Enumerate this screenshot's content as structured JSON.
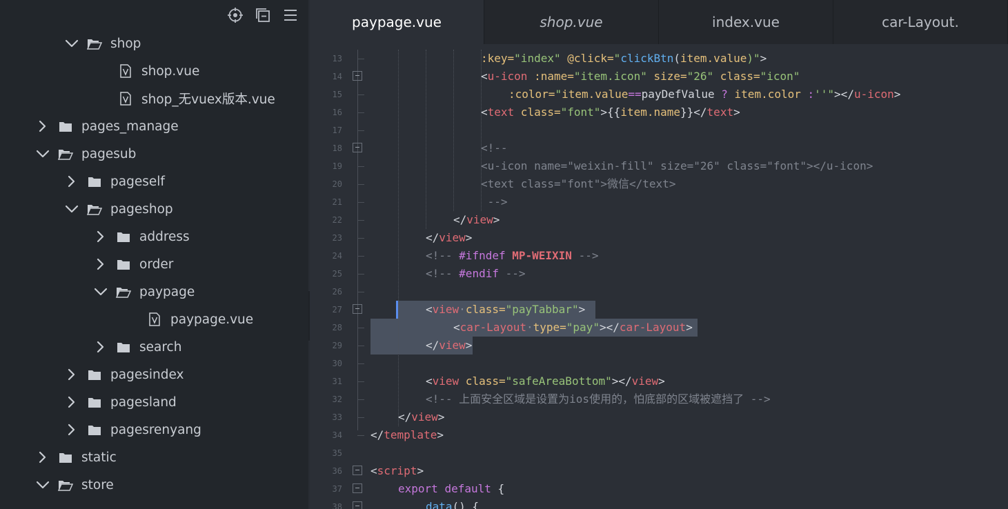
{
  "sidebar": {
    "toolbar": [
      {
        "name": "locate-icon"
      },
      {
        "name": "collapse-all-icon"
      },
      {
        "name": "menu-icon"
      }
    ],
    "tree": [
      {
        "label": "shop",
        "type": "folder",
        "expanded": true,
        "depth": 1
      },
      {
        "label": "shop.vue",
        "type": "file",
        "depth": 2
      },
      {
        "label": "shop_无vuex版本.vue",
        "type": "file",
        "depth": 2
      },
      {
        "label": "pages_manage",
        "type": "folder",
        "expanded": false,
        "depth": 0
      },
      {
        "label": "pagesub",
        "type": "folder",
        "expanded": true,
        "depth": 0
      },
      {
        "label": "pageself",
        "type": "folder",
        "expanded": false,
        "depth": 1
      },
      {
        "label": "pageshop",
        "type": "folder",
        "expanded": true,
        "depth": 1
      },
      {
        "label": "address",
        "type": "folder",
        "expanded": false,
        "depth": 2
      },
      {
        "label": "order",
        "type": "folder",
        "expanded": false,
        "depth": 2
      },
      {
        "label": "paypage",
        "type": "folder",
        "expanded": true,
        "depth": 2
      },
      {
        "label": "paypage.vue",
        "type": "file",
        "depth": 3
      },
      {
        "label": "search",
        "type": "folder",
        "expanded": false,
        "depth": 2
      },
      {
        "label": "pagesindex",
        "type": "folder",
        "expanded": false,
        "depth": 1
      },
      {
        "label": "pagesland",
        "type": "folder",
        "expanded": false,
        "depth": 1
      },
      {
        "label": "pagesrenyang",
        "type": "folder",
        "expanded": false,
        "depth": 1
      },
      {
        "label": "static",
        "type": "folder",
        "expanded": false,
        "depth": 0
      },
      {
        "label": "store",
        "type": "folder",
        "expanded": true,
        "depth": 0
      }
    ]
  },
  "tabs": [
    {
      "label": "paypage.vue",
      "active": true,
      "italic": false
    },
    {
      "label": "shop.vue",
      "active": false,
      "italic": true
    },
    {
      "label": "index.vue",
      "active": false,
      "italic": false
    },
    {
      "label": "car-Layout.",
      "active": false,
      "italic": false
    }
  ],
  "editor": {
    "lines": [
      {
        "n": "13",
        "fold": false,
        "indent": 4,
        "tokens": [
          [
            ":key=",
            "t-attr"
          ],
          [
            "\"index\"",
            "t-str"
          ],
          [
            " @click=",
            "t-attr"
          ],
          [
            "\"",
            "t-str"
          ],
          [
            "clickBtn",
            "t-fn"
          ],
          [
            "(",
            "t-p"
          ],
          [
            "item.value",
            "t-var"
          ],
          [
            ")\"",
            "t-str"
          ],
          [
            ">",
            "t-p"
          ]
        ]
      },
      {
        "n": "14",
        "fold": true,
        "indent": 4,
        "tokens": [
          [
            "<",
            "t-p"
          ],
          [
            "u-icon",
            "t-tag"
          ],
          [
            " :name=",
            "t-attr"
          ],
          [
            "\"item.icon\"",
            "t-str"
          ],
          [
            " size=",
            "t-attr"
          ],
          [
            "\"26\"",
            "t-str"
          ],
          [
            " class=",
            "t-attr"
          ],
          [
            "\"icon\"",
            "t-str"
          ]
        ]
      },
      {
        "n": "15",
        "fold": false,
        "indent": 5,
        "tokens": [
          [
            ":color=",
            "t-attr"
          ],
          [
            "\"",
            "t-str"
          ],
          [
            "item.value",
            "t-var"
          ],
          [
            "==",
            "t-kw"
          ],
          [
            "payDefValue ",
            "t-p"
          ],
          [
            "?",
            "t-kw"
          ],
          [
            " item.color ",
            "t-var"
          ],
          [
            ":",
            "t-kw"
          ],
          [
            "''\"",
            "t-str"
          ],
          [
            "></",
            "t-p"
          ],
          [
            "u-icon",
            "t-tag"
          ],
          [
            ">",
            "t-p"
          ]
        ]
      },
      {
        "n": "16",
        "fold": false,
        "indent": 4,
        "tokens": [
          [
            "<",
            "t-p"
          ],
          [
            "text",
            "t-tag"
          ],
          [
            " class=",
            "t-attr"
          ],
          [
            "\"font\"",
            "t-str"
          ],
          [
            ">{{",
            "t-p"
          ],
          [
            "item.name",
            "t-var"
          ],
          [
            "}}</",
            "t-p"
          ],
          [
            "text",
            "t-tag"
          ],
          [
            ">",
            "t-p"
          ]
        ]
      },
      {
        "n": "17",
        "fold": false,
        "indent": 0,
        "tokens": []
      },
      {
        "n": "18",
        "fold": true,
        "indent": 4,
        "tokens": [
          [
            "<!--",
            "t-cmt"
          ]
        ]
      },
      {
        "n": "19",
        "fold": false,
        "indent": 4,
        "tokens": [
          [
            "<u-icon name=\"weixin-fill\" size=\"26\" class=\"font\"></u-icon>",
            "t-cmt"
          ]
        ]
      },
      {
        "n": "20",
        "fold": false,
        "indent": 4,
        "tokens": [
          [
            "<text class=\"font\">微信</text>",
            "t-cmt"
          ]
        ]
      },
      {
        "n": "21",
        "fold": false,
        "indent": 4,
        "tokens": [
          [
            " -->",
            "t-cmt"
          ]
        ]
      },
      {
        "n": "22",
        "fold": false,
        "indent": 3,
        "tokens": [
          [
            "</",
            "t-p"
          ],
          [
            "view",
            "t-tag"
          ],
          [
            ">",
            "t-p"
          ]
        ]
      },
      {
        "n": "23",
        "fold": false,
        "indent": 2,
        "tokens": [
          [
            "</",
            "t-p"
          ],
          [
            "view",
            "t-tag"
          ],
          [
            ">",
            "t-p"
          ]
        ]
      },
      {
        "n": "24",
        "fold": false,
        "indent": 2,
        "tokens": [
          [
            "<!-- ",
            "t-cmt"
          ],
          [
            "#ifndef ",
            "t-kw"
          ],
          [
            "MP-WEIXIN",
            "t-def"
          ],
          [
            " -->",
            "t-cmt"
          ]
        ]
      },
      {
        "n": "25",
        "fold": false,
        "indent": 2,
        "tokens": [
          [
            "<!-- ",
            "t-cmt"
          ],
          [
            "#endif",
            "t-kw"
          ],
          [
            " -->",
            "t-cmt"
          ]
        ]
      },
      {
        "n": "26",
        "fold": false,
        "indent": 0,
        "tokens": []
      },
      {
        "n": "27",
        "fold": true,
        "indent": 2,
        "sel": true,
        "tokens": [
          [
            "<",
            "t-p"
          ],
          [
            "view",
            "t-tag"
          ],
          [
            "·",
            "t-gr"
          ],
          [
            "class=",
            "t-attr"
          ],
          [
            "\"payTabbar\"",
            "t-str"
          ],
          [
            ">",
            "t-p"
          ]
        ]
      },
      {
        "n": "28",
        "fold": false,
        "indent": 3,
        "sel": true,
        "tokens": [
          [
            "<",
            "t-p"
          ],
          [
            "car-Layout",
            "t-tag"
          ],
          [
            "·",
            "t-gr"
          ],
          [
            "type=",
            "t-attr"
          ],
          [
            "\"pay\"",
            "t-str"
          ],
          [
            "></",
            "t-p"
          ],
          [
            "car-Layout",
            "t-tag"
          ],
          [
            ">",
            "t-p"
          ]
        ]
      },
      {
        "n": "29",
        "fold": false,
        "indent": 2,
        "sel": true,
        "tokens": [
          [
            "</",
            "t-p"
          ],
          [
            "view",
            "t-tag"
          ],
          [
            ">",
            "t-p"
          ]
        ]
      },
      {
        "n": "30",
        "fold": false,
        "indent": 0,
        "tokens": []
      },
      {
        "n": "31",
        "fold": false,
        "indent": 2,
        "tokens": [
          [
            "<",
            "t-p"
          ],
          [
            "view",
            "t-tag"
          ],
          [
            " class=",
            "t-attr"
          ],
          [
            "\"safeAreaBottom\"",
            "t-str"
          ],
          [
            "></",
            "t-p"
          ],
          [
            "view",
            "t-tag"
          ],
          [
            ">",
            "t-p"
          ]
        ]
      },
      {
        "n": "32",
        "fold": false,
        "indent": 2,
        "tokens": [
          [
            "<!-- 上面安全区域是设置为ios使用的，怕底部的区域被遮挡了 -->",
            "t-cmt"
          ]
        ]
      },
      {
        "n": "33",
        "fold": false,
        "indent": 1,
        "tokens": [
          [
            "</",
            "t-p"
          ],
          [
            "view",
            "t-tag"
          ],
          [
            ">",
            "t-p"
          ]
        ]
      },
      {
        "n": "34",
        "fold": false,
        "indent": 0,
        "tokens": [
          [
            "</",
            "t-p"
          ],
          [
            "template",
            "t-tag"
          ],
          [
            ">",
            "t-p"
          ]
        ]
      },
      {
        "n": "35",
        "fold": false,
        "indent": 0,
        "tokens": []
      },
      {
        "n": "36",
        "fold": true,
        "indent": 0,
        "tokens": [
          [
            "<",
            "t-p"
          ],
          [
            "script",
            "t-tag"
          ],
          [
            ">",
            "t-p"
          ]
        ]
      },
      {
        "n": "37",
        "fold": true,
        "indent": 1,
        "tokens": [
          [
            "export ",
            "t-kw"
          ],
          [
            "default ",
            "t-kw"
          ],
          [
            "{",
            "t-p"
          ]
        ]
      },
      {
        "n": "38",
        "fold": true,
        "indent": 2,
        "tokens": [
          [
            "data",
            "t-fn"
          ],
          [
            "() {",
            "t-p"
          ]
        ]
      }
    ]
  }
}
